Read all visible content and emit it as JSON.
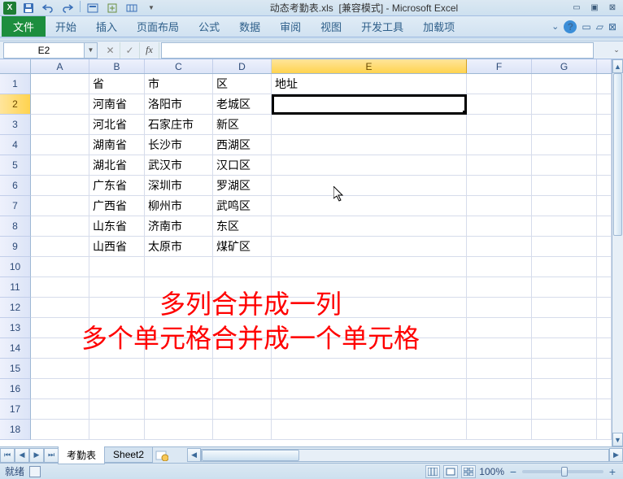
{
  "titlebar": {
    "filename": "动态考勤表.xls",
    "compat": "[兼容模式]",
    "app": "Microsoft Excel"
  },
  "ribbon": {
    "file": "文件",
    "tabs": [
      "开始",
      "插入",
      "页面布局",
      "公式",
      "数据",
      "审阅",
      "视图",
      "开发工具",
      "加载项"
    ]
  },
  "formula": {
    "namebox": "E2",
    "value": ""
  },
  "columns": [
    "A",
    "B",
    "C",
    "D",
    "E",
    "F",
    "G"
  ],
  "active_col_index": 4,
  "active_row": 2,
  "rows_shown": 18,
  "grid": {
    "r1": {
      "B": "省",
      "C": "市",
      "D": "区",
      "E": "地址"
    },
    "r2": {
      "B": "河南省",
      "C": "洛阳市",
      "D": "老城区"
    },
    "r3": {
      "B": "河北省",
      "C": "石家庄市",
      "D": "新区"
    },
    "r4": {
      "B": "湖南省",
      "C": "长沙市",
      "D": "西湖区"
    },
    "r5": {
      "B": "湖北省",
      "C": "武汉市",
      "D": "汉口区"
    },
    "r6": {
      "B": "广东省",
      "C": "深圳市",
      "D": "罗湖区"
    },
    "r7": {
      "B": "广西省",
      "C": "柳州市",
      "D": "武鸣区"
    },
    "r8": {
      "B": "山东省",
      "C": "济南市",
      "D": "东区"
    },
    "r9": {
      "B": "山西省",
      "C": "太原市",
      "D": "煤矿区"
    }
  },
  "overlay": {
    "line1": "多列合并成一列",
    "line2": "多个单元格合并成一个单元格"
  },
  "sheets": {
    "active": "考勤表",
    "others": [
      "Sheet2"
    ]
  },
  "status": {
    "mode": "就绪",
    "zoom": "100%"
  }
}
